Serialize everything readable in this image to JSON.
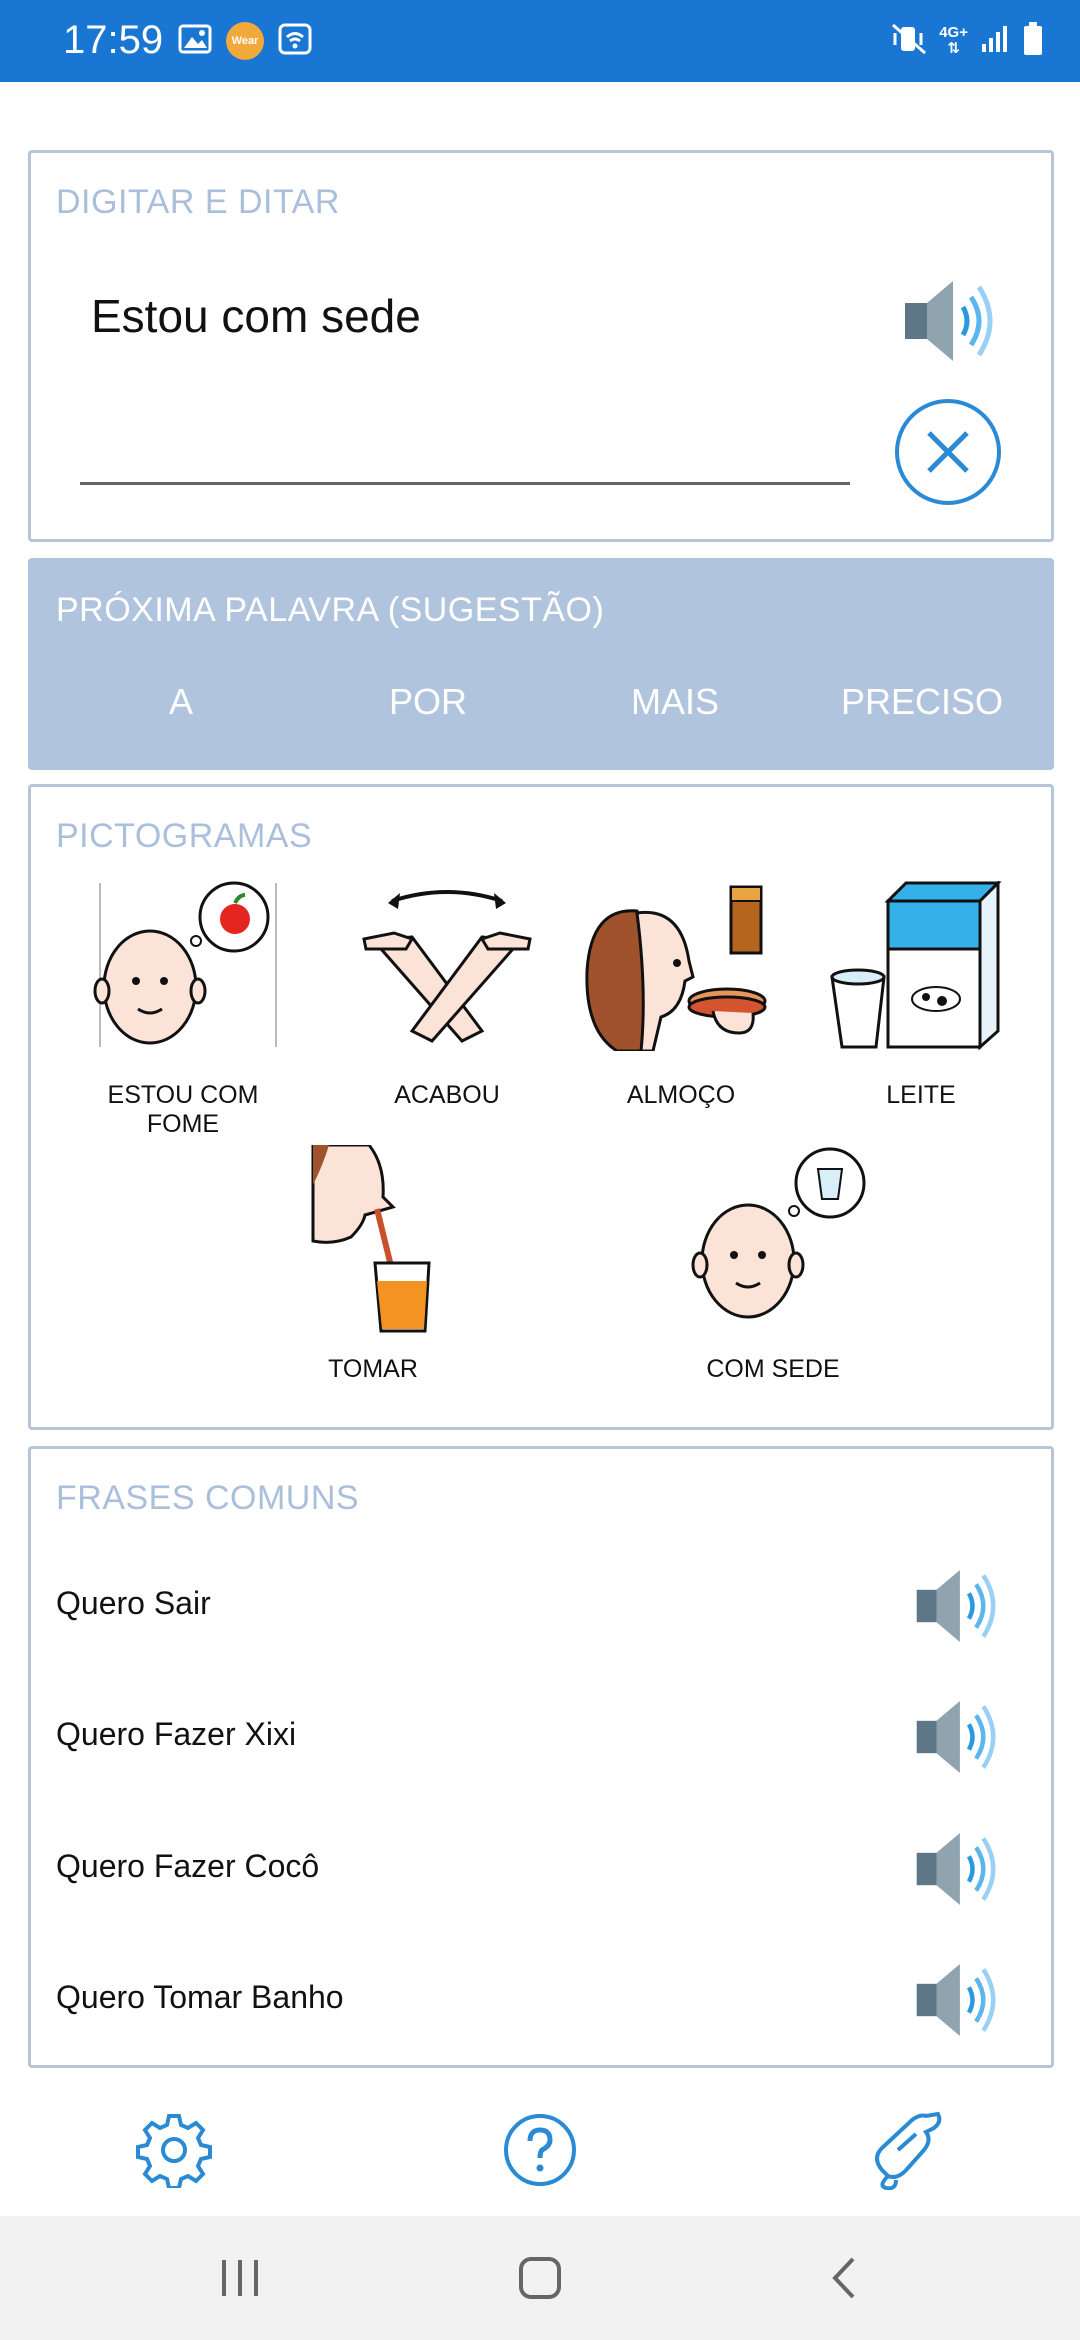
{
  "status_bar": {
    "time": "17:59",
    "wear_badge": "Wear",
    "network": "4G+",
    "icons": [
      "gallery-icon",
      "wear-os-icon",
      "wifi-calling-icon",
      "mute-vibrate-icon",
      "mobile-data-icon",
      "signal-icon",
      "battery-icon"
    ]
  },
  "typing": {
    "title": "DIGITAR E DITAR",
    "text": "Estou com sede",
    "speak_icon": "speaker-icon",
    "clear_icon": "clear-icon"
  },
  "suggestions": {
    "title": "PRÓXIMA PALAVRA (SUGESTÃO)",
    "words": [
      "A",
      "POR",
      "MAIS",
      "PRECISO"
    ]
  },
  "pictograms": {
    "title": "PICTOGRAMAS",
    "items": [
      {
        "label": "ESTOU COM FOME",
        "icon": "hungry-face-icon"
      },
      {
        "label": "ACABOU",
        "icon": "crossed-arms-icon"
      },
      {
        "label": "ALMOÇO",
        "icon": "lunch-icon"
      },
      {
        "label": "LEITE",
        "icon": "milk-icon"
      },
      {
        "label": "TOMAR",
        "icon": "drink-straw-icon"
      },
      {
        "label": "COM SEDE",
        "icon": "thirsty-face-icon"
      }
    ]
  },
  "phrases": {
    "title": "FRASES COMUNS",
    "items": [
      "Quero Sair",
      "Quero Fazer Xixi",
      "Quero Fazer Cocô",
      "Quero Tomar Banho"
    ]
  },
  "toolbar": {
    "icons": [
      "settings-icon",
      "help-icon",
      "sign-language-icon"
    ]
  },
  "colors": {
    "status_bar": "#1976d2",
    "accent": "#2a8ad4",
    "card_title": "#a9bfdc",
    "suggest_bg": "#b0c4de",
    "card_border": "#b6c6d8"
  }
}
